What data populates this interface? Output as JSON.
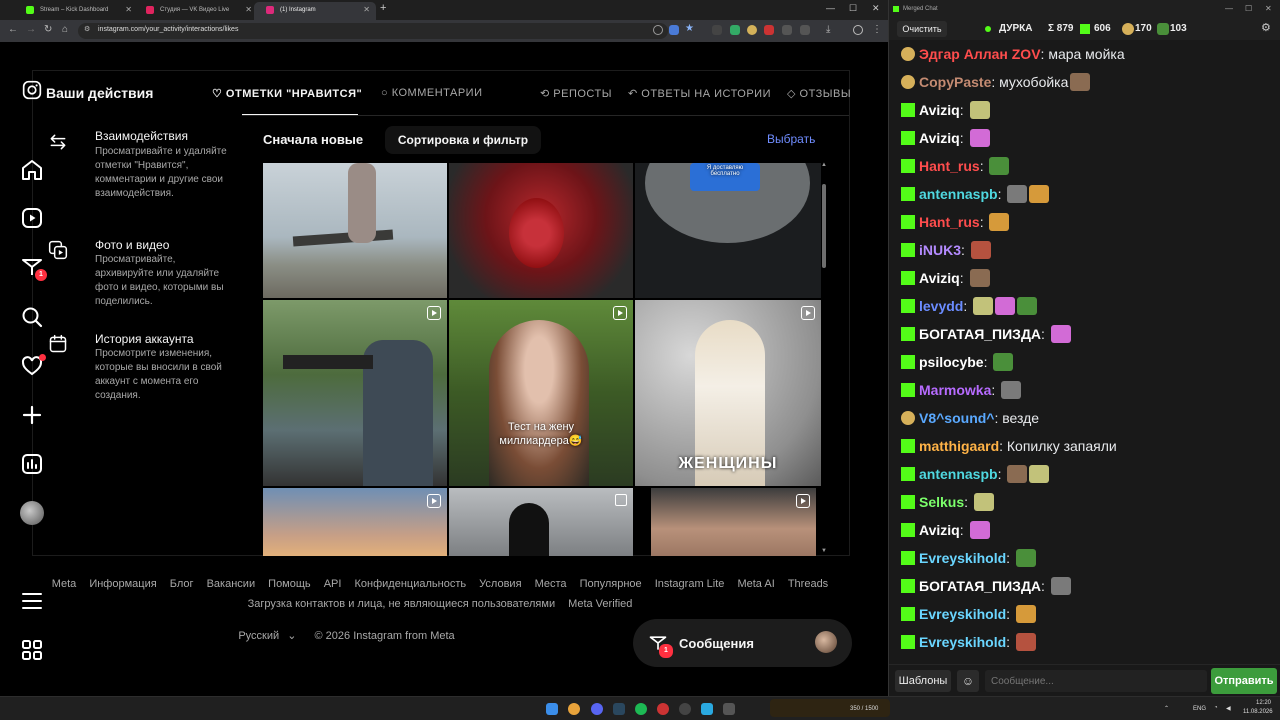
{
  "browser": {
    "tabs": [
      {
        "title": "Stream – Kick Dashboard",
        "color": "#53fc18"
      },
      {
        "title": "Студия — VK Видео Live",
        "color": "#e0245e"
      },
      {
        "title": "(1) Instagram",
        "color": "#dd2a7b"
      }
    ],
    "url": "instagram.com/your_activity/interactions/likes",
    "new_tab": "+"
  },
  "instagram": {
    "activity_title": "Ваши действия",
    "tabs": [
      "ОТМЕТКИ \"НРАВИТСЯ\"",
      "КОММЕНТАРИИ",
      "РЕПОСТЫ",
      "ОТВЕТЫ НА ИСТОРИИ",
      "ОТЗЫВЫ"
    ],
    "items": [
      {
        "title": "Взаимодействия",
        "desc": "Просматривайте и удаляйте отметки \"Нравится\", комментарии и другие свои взаимодействия."
      },
      {
        "title": "Фото и видео",
        "desc": "Просматривайте, архивируйте или удаляйте фото и видео, которыми вы поделились."
      },
      {
        "title": "История аккаунта",
        "desc": "Просмотрите изменения, которые вы вносили в свой аккаунт с момента его создания."
      }
    ],
    "sort_label": "Сначала новые",
    "filter_button": "Сортировка и фильтр",
    "select_link": "Выбрать",
    "notif_count": "1",
    "captions": {
      "cell5": "Тест на жену миллиардера😅",
      "cell6": "ЖЕНЩИНЫ",
      "sticker": "Я доставляю бесплатно"
    },
    "footer_links": [
      "Meta",
      "Информация",
      "Блог",
      "Вакансии",
      "Помощь",
      "API",
      "Конфиденциальность",
      "Условия",
      "Места",
      "Популярное",
      "Instagram Lite",
      "Meta AI",
      "Threads"
    ],
    "footer_links2": [
      "Загрузка контактов и лица, не являющиеся пользователями",
      "Meta Verified"
    ],
    "language": "Русский",
    "copyright": "© 2026 Instagram from Meta",
    "messages_label": "Сообщения",
    "messages_badge": "1"
  },
  "chat": {
    "window_title": "Merged Chat",
    "clear_button": "Очистить",
    "streamer": "ДУРКА",
    "stats": {
      "total": "Σ 879",
      "kick": "606",
      "vk": "170",
      "other": "103"
    },
    "messages": [
      {
        "user": "Эдгар Аллан ZOV",
        "text": "мара мойка",
        "color": "#ff4d4d",
        "badge": "vk",
        "emotes": 0
      },
      {
        "user": "CopyPaste",
        "text": "мухобойка",
        "color": "#c48b72",
        "badge": "vk",
        "emotes": 1
      },
      {
        "user": "Aviziq",
        "text": "",
        "color": "#ffffff",
        "badge": "kick",
        "emotes": 1
      },
      {
        "user": "Aviziq",
        "text": "",
        "color": "#ffffff",
        "badge": "kick",
        "emotes": 1
      },
      {
        "user": "Hant_rus",
        "text": "",
        "color": "#ff4d4d",
        "badge": "kick",
        "emotes": 1
      },
      {
        "user": "antennaspb",
        "text": "",
        "color": "#4fd8e0",
        "badge": "kick",
        "emotes": 2
      },
      {
        "user": "Hant_rus",
        "text": "",
        "color": "#ff4d4d",
        "badge": "kick",
        "emotes": 1
      },
      {
        "user": "iNUK3",
        "text": "",
        "color": "#b48bff",
        "badge": "kick",
        "emotes": 1
      },
      {
        "user": "Aviziq",
        "text": "",
        "color": "#ffffff",
        "badge": "kick",
        "emotes": 1
      },
      {
        "user": "levydd",
        "text": "",
        "color": "#6b8cff",
        "badge": "kick",
        "emotes": 3
      },
      {
        "user": "БОГАТАЯ_ПИЗДА",
        "text": "",
        "color": "#ffffff",
        "badge": "kick",
        "emotes": 1
      },
      {
        "user": "psilocybe",
        "text": "",
        "color": "#ffffff",
        "badge": "kick",
        "emotes": 1
      },
      {
        "user": "Marmowka",
        "text": "",
        "color": "#b76bff",
        "badge": "kick",
        "emotes": 1
      },
      {
        "user": "V8^sound^",
        "text": "везде",
        "color": "#5aa9ff",
        "badge": "vk",
        "emotes": 0
      },
      {
        "user": "matthigaard",
        "text": "Копилку запаяли",
        "color": "#ffb347",
        "badge": "kick",
        "emotes": 0
      },
      {
        "user": "antennaspb",
        "text": "",
        "color": "#4fd8e0",
        "badge": "kick",
        "emotes": 2
      },
      {
        "user": "Selkus",
        "text": "",
        "color": "#7cff6b",
        "badge": "kick",
        "emotes": 1
      },
      {
        "user": "Aviziq",
        "text": "",
        "color": "#ffffff",
        "badge": "kick",
        "emotes": 1
      },
      {
        "user": "Evreyskihold",
        "text": "",
        "color": "#6ad6ff",
        "badge": "kick",
        "emotes": 1
      },
      {
        "user": "БОГАТАЯ_ПИЗДА",
        "text": "",
        "color": "#ffffff",
        "badge": "kick",
        "emotes": 1
      },
      {
        "user": "Evreyskihold",
        "text": "",
        "color": "#6ad6ff",
        "badge": "kick",
        "emotes": 1
      },
      {
        "user": "Evreyskihold",
        "text": "",
        "color": "#6ad6ff",
        "badge": "kick",
        "emotes": 1
      }
    ],
    "templates_button": "Шаблоны",
    "input_placeholder": "Сообщение...",
    "send_button": "Отправить"
  },
  "taskbar": {
    "lang": "ENG",
    "time": "12:20",
    "date": "11.08.2026",
    "tray_text": "350 / 1500"
  },
  "colors": {
    "kick": "#53fc18",
    "ig_link": "#708dff",
    "send": "#3c9c3c"
  }
}
